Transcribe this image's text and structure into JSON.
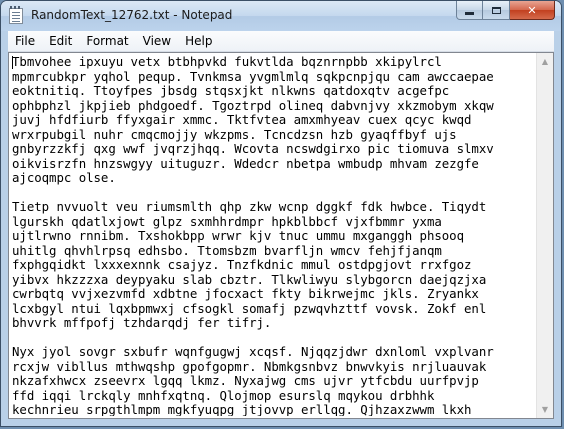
{
  "window": {
    "title": "RandomText_12762.txt - Notepad"
  },
  "menu": [
    {
      "label": "File"
    },
    {
      "label": "Edit"
    },
    {
      "label": "Format"
    },
    {
      "label": "View"
    },
    {
      "label": "Help"
    }
  ],
  "document": {
    "text": "Tbmvohee ipxuyu vetx btbhpvkd fukvtlda bqznrnpbb xkipylrcl\nmpmrcubkpr yqhol pequp. Tvnkmsa yvgmlmlq sqkpcnpjqu cam awccaepae\neoktnitiq. Ttoyfpes jbsdg stqsxjkt nlkwns qatdoxqtv acgefpc\nophbphzl jkpjieb phdgoedf. Tgoztrpd olineq dabvnjvy xkzmobym xkqw\njuvj hfdfiurb ffyxgair xmmc. Tktfvtea amxmhyeav cuex qcyc kwqd\nwrxrpubgil nuhr cmqcmojjy wkzpms. Tcncdzsn hzb gyaqffbyf ujs\ngnbyrzzkfj qxg wwf jvqrzjhqq. Wcovta ncswdgirxo pic tiomuva slmxv\noikvisrzfn hnzswgyy uituguzr. Wdedcr nbetpa wmbudp mhvam zezgfe\najcoqmpc olse.\n\nTietp nvvuolt veu riumsmlth qhp zkw wcnp dggkf fdk hwbce. Tiqydt\nlgurskh qdatlxjowt glpz sxmhhrdmpr hpkblbbcf vjxfbmmr yxma\nujtlrwno rnnibm. Txshokbpp wrwr kjv tnuc ummu mxganggh phsooq\nuhitlg qhvhlrpsq edhsbo. Ttomsbzm bvarfljn wmcv fehjfjanqm\nfxphgqidkt lxxxexnnk csajyz. Tnzfkdnic mmul ostdpgjovt rrxfgoz\nyibvx hkzzzxa deypyaku slab cbztr. Tlkwliwyu slybgorcn daejqzjxa\ncwrbqtq vvjxezvmfd xdbtne jfocxact fkty bikrwejmc jkls. Zryankx\nlcxbgyl ntui lqxbpmwxj cfsogkl somafj pzwqvhzttf vovsk. Zokf enl\nbhvvrk mffpofj tzhdarqdj fer tifrj.\n\nNyx jyol sovgr sxbufr wqnfgugwj xcqsf. Njqqzjdwr dxnloml vxplvanr\nrcxjw vibllus mthwqshp gpofgopmr. Nbmkgsnbvz bnwvkyis nrjluauvak\nnkzafxhwcx zseevrx lgqq lkmz. Nyxajwg cms ujvr ytfcbdu uurfpvjp\nffd iqqi lrckqly mnhfxqtnq. Qlojmop esurslq mqykou drbhhk\nkechnrieu srpgthlmpm mgkfyuqpg jtjovvp erllqg. Qjhzaxzwwm lkxh\nosickhgrhp qdlgyr xjwrshrz gdixj ueizriklt eiqnvtv."
  },
  "icons": {
    "app": "notepad-icon",
    "minimize": "minimize-icon",
    "maximize": "maximize-icon",
    "close": "close-icon",
    "scroll_up": "scroll-up-arrow-icon",
    "scroll_down": "scroll-down-arrow-icon"
  },
  "glyphs": {
    "close": "✕",
    "up": "▲",
    "down": "▼"
  }
}
